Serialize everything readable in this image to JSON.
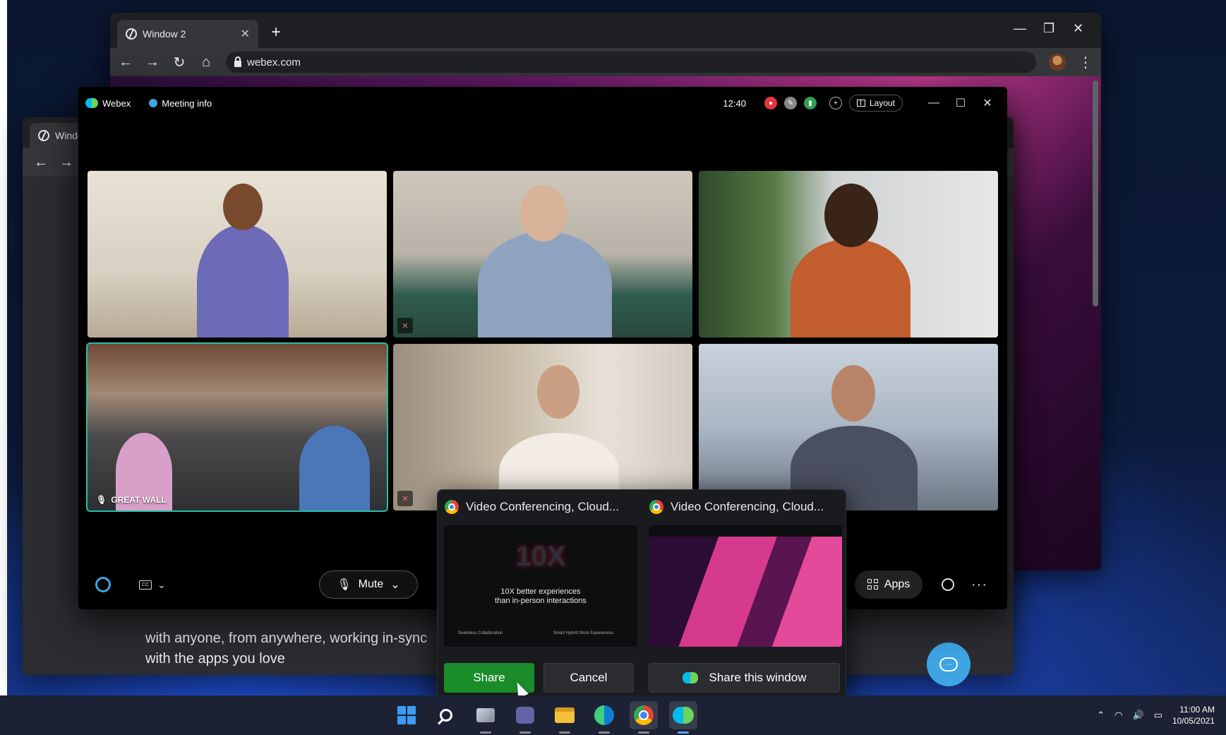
{
  "browser_back": {
    "tab_title": "Window 2",
    "url": "webex.com"
  },
  "browser_front": {
    "tab_title": "Window",
    "body_text_line1": "with anyone, from anywhere, working in-sync",
    "body_text_line2": "with the apps you love"
  },
  "webex": {
    "app_name": "Webex",
    "meeting_info_label": "Meeting info",
    "time": "12:40",
    "layout_label": "Layout",
    "tiles": [
      {
        "label": ""
      },
      {
        "label": ""
      },
      {
        "label": ""
      },
      {
        "label": "GREAT WALL"
      },
      {
        "label": ""
      },
      {
        "label": ""
      }
    ],
    "mute_label": "Mute",
    "apps_label": "Apps"
  },
  "share_popup": {
    "windows": [
      {
        "title": "Video Conferencing, Cloud..."
      },
      {
        "title": "Video Conferencing, Cloud..."
      }
    ],
    "thumb1_headline": "10X",
    "thumb1_sub_line1": "10X better experiences",
    "thumb1_sub_line2": "than in-person interactions",
    "thumb1_feat1": "Seamless Collaboration",
    "thumb1_feat2": "Smart Hybrid Work Experiences",
    "share_label": "Share",
    "cancel_label": "Cancel",
    "share_window_label": "Share this window"
  },
  "taskbar": {
    "time": "11:00 AM",
    "date": "10/05/2021"
  },
  "colors": {
    "active_speaker": "#22c0a6",
    "share_button": "#1a8c2a",
    "webex_blue": "#00bceb",
    "webex_green": "#6cd35c"
  }
}
